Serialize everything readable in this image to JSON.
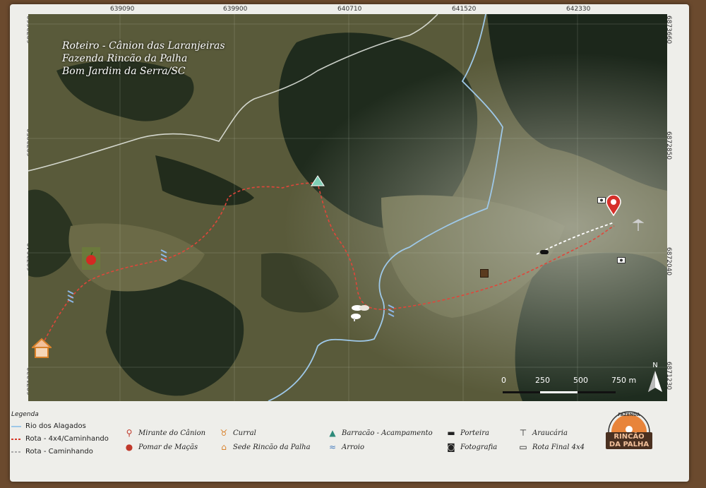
{
  "coords": {
    "top": [
      "639090",
      "639900",
      "640710",
      "641520",
      "642330"
    ],
    "left": [
      "6873660",
      "6872850",
      "6872040",
      "6871230"
    ],
    "right": [
      "6873660",
      "6872850",
      "6872040",
      "6871230"
    ]
  },
  "title": {
    "line1": "Roteiro - Cânion das Laranjeiras",
    "line2": "Fazenda Rincão da Palha",
    "line3": "Bom Jardim da Serra/SC"
  },
  "scale": {
    "ticks": [
      "0",
      "250",
      "500",
      "750 m"
    ]
  },
  "north_label": "N",
  "legend": {
    "title": "Legenda",
    "items": [
      {
        "label": "Rio dos Alagados",
        "icon": "river-line",
        "color": "#9ec8e8"
      },
      {
        "label": "Rota - 4x4/Caminhando",
        "icon": "dashed-red-line",
        "color": "#d63a2a"
      },
      {
        "label": "Rota - Caminhando",
        "icon": "dashed-white-line",
        "color": "#ffffff"
      },
      {
        "label": "Mirante do Cânion",
        "icon": "pin-icon",
        "color": "#c0392b"
      },
      {
        "label": "Pomar de Maçãs",
        "icon": "apple-icon",
        "color": "#c0392b"
      },
      {
        "label": "Curral",
        "icon": "cattle-icon",
        "color": "#d9822b"
      },
      {
        "label": "Sede Rincão da Palha",
        "icon": "house-icon",
        "color": "#d9822b"
      },
      {
        "label": "Barracão - Acampamento",
        "icon": "tent-icon",
        "color": "#2e8b7a"
      },
      {
        "label": "Arroio",
        "icon": "waves-icon",
        "color": "#4a7fbf"
      },
      {
        "label": "Porteira",
        "icon": "gate-icon",
        "color": "#333333"
      },
      {
        "label": "Fotografia",
        "icon": "camera-icon",
        "color": "#333333"
      },
      {
        "label": "Araucária",
        "icon": "araucaria-icon",
        "color": "#333333"
      },
      {
        "label": "Rota Final 4x4",
        "icon": "car-icon",
        "color": "#333333"
      }
    ]
  },
  "logo": {
    "top": "FAZENDA",
    "line1": "RINCÃO",
    "line2": "DA PALHA"
  }
}
